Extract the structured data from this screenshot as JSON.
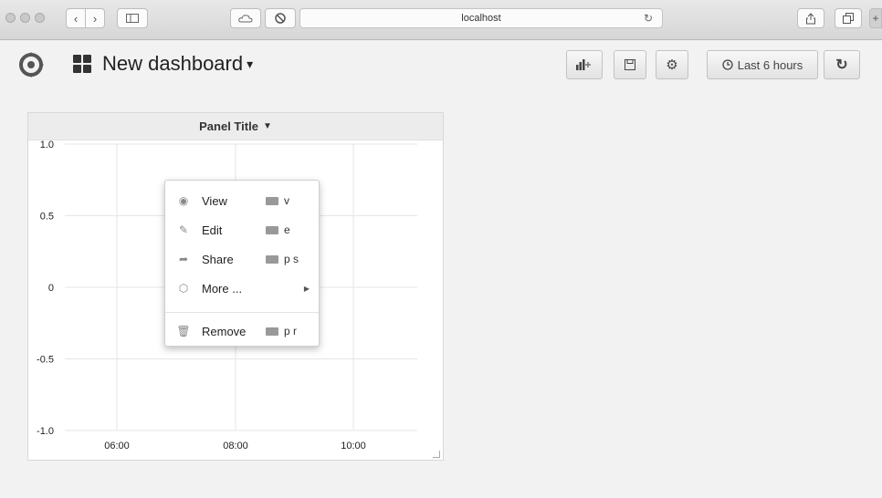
{
  "browser": {
    "url": "localhost"
  },
  "header": {
    "title": "New dashboard",
    "time_range": "Last 6 hours"
  },
  "panel": {
    "title": "Panel Title",
    "menu": [
      {
        "label": "View",
        "shortcut": "v",
        "icon": "eye-icon"
      },
      {
        "label": "Edit",
        "shortcut": "e",
        "icon": "edit-icon"
      },
      {
        "label": "Share",
        "shortcut": "p s",
        "icon": "share-icon"
      },
      {
        "label": "More ...",
        "shortcut": "",
        "icon": "cube-icon"
      },
      {
        "label": "Remove",
        "shortcut": "p r",
        "icon": "trash-icon"
      }
    ]
  },
  "chart_data": {
    "type": "line",
    "x_ticks": [
      "06:00",
      "08:00",
      "10:00"
    ],
    "y_ticks": [
      "1.0",
      "0.5",
      "0",
      "-0.5",
      "-1.0"
    ],
    "ylim": [
      -1.0,
      1.0
    ],
    "series": []
  }
}
